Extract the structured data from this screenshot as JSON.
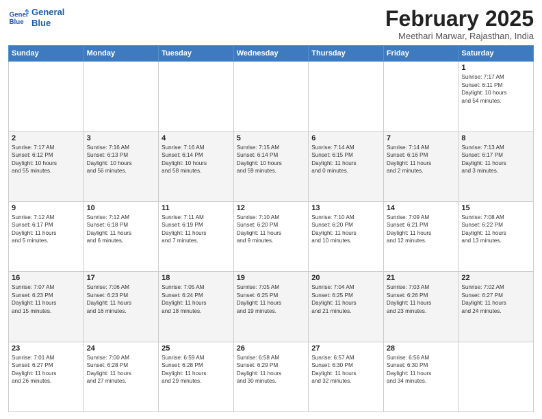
{
  "header": {
    "logo_line1": "General",
    "logo_line2": "Blue",
    "title": "February 2025",
    "subtitle": "Meethari Marwar, Rajasthan, India"
  },
  "weekdays": [
    "Sunday",
    "Monday",
    "Tuesday",
    "Wednesday",
    "Thursday",
    "Friday",
    "Saturday"
  ],
  "weeks": [
    [
      {
        "day": "",
        "info": ""
      },
      {
        "day": "",
        "info": ""
      },
      {
        "day": "",
        "info": ""
      },
      {
        "day": "",
        "info": ""
      },
      {
        "day": "",
        "info": ""
      },
      {
        "day": "",
        "info": ""
      },
      {
        "day": "1",
        "info": "Sunrise: 7:17 AM\nSunset: 6:11 PM\nDaylight: 10 hours\nand 54 minutes."
      }
    ],
    [
      {
        "day": "2",
        "info": "Sunrise: 7:17 AM\nSunset: 6:12 PM\nDaylight: 10 hours\nand 55 minutes."
      },
      {
        "day": "3",
        "info": "Sunrise: 7:16 AM\nSunset: 6:13 PM\nDaylight: 10 hours\nand 56 minutes."
      },
      {
        "day": "4",
        "info": "Sunrise: 7:16 AM\nSunset: 6:14 PM\nDaylight: 10 hours\nand 58 minutes."
      },
      {
        "day": "5",
        "info": "Sunrise: 7:15 AM\nSunset: 6:14 PM\nDaylight: 10 hours\nand 59 minutes."
      },
      {
        "day": "6",
        "info": "Sunrise: 7:14 AM\nSunset: 6:15 PM\nDaylight: 11 hours\nand 0 minutes."
      },
      {
        "day": "7",
        "info": "Sunrise: 7:14 AM\nSunset: 6:16 PM\nDaylight: 11 hours\nand 2 minutes."
      },
      {
        "day": "8",
        "info": "Sunrise: 7:13 AM\nSunset: 6:17 PM\nDaylight: 11 hours\nand 3 minutes."
      }
    ],
    [
      {
        "day": "9",
        "info": "Sunrise: 7:12 AM\nSunset: 6:17 PM\nDaylight: 11 hours\nand 5 minutes."
      },
      {
        "day": "10",
        "info": "Sunrise: 7:12 AM\nSunset: 6:18 PM\nDaylight: 11 hours\nand 6 minutes."
      },
      {
        "day": "11",
        "info": "Sunrise: 7:11 AM\nSunset: 6:19 PM\nDaylight: 11 hours\nand 7 minutes."
      },
      {
        "day": "12",
        "info": "Sunrise: 7:10 AM\nSunset: 6:20 PM\nDaylight: 11 hours\nand 9 minutes."
      },
      {
        "day": "13",
        "info": "Sunrise: 7:10 AM\nSunset: 6:20 PM\nDaylight: 11 hours\nand 10 minutes."
      },
      {
        "day": "14",
        "info": "Sunrise: 7:09 AM\nSunset: 6:21 PM\nDaylight: 11 hours\nand 12 minutes."
      },
      {
        "day": "15",
        "info": "Sunrise: 7:08 AM\nSunset: 6:22 PM\nDaylight: 11 hours\nand 13 minutes."
      }
    ],
    [
      {
        "day": "16",
        "info": "Sunrise: 7:07 AM\nSunset: 6:23 PM\nDaylight: 11 hours\nand 15 minutes."
      },
      {
        "day": "17",
        "info": "Sunrise: 7:06 AM\nSunset: 6:23 PM\nDaylight: 11 hours\nand 16 minutes."
      },
      {
        "day": "18",
        "info": "Sunrise: 7:05 AM\nSunset: 6:24 PM\nDaylight: 11 hours\nand 18 minutes."
      },
      {
        "day": "19",
        "info": "Sunrise: 7:05 AM\nSunset: 6:25 PM\nDaylight: 11 hours\nand 19 minutes."
      },
      {
        "day": "20",
        "info": "Sunrise: 7:04 AM\nSunset: 6:25 PM\nDaylight: 11 hours\nand 21 minutes."
      },
      {
        "day": "21",
        "info": "Sunrise: 7:03 AM\nSunset: 6:26 PM\nDaylight: 11 hours\nand 23 minutes."
      },
      {
        "day": "22",
        "info": "Sunrise: 7:02 AM\nSunset: 6:27 PM\nDaylight: 11 hours\nand 24 minutes."
      }
    ],
    [
      {
        "day": "23",
        "info": "Sunrise: 7:01 AM\nSunset: 6:27 PM\nDaylight: 11 hours\nand 26 minutes."
      },
      {
        "day": "24",
        "info": "Sunrise: 7:00 AM\nSunset: 6:28 PM\nDaylight: 11 hours\nand 27 minutes."
      },
      {
        "day": "25",
        "info": "Sunrise: 6:59 AM\nSunset: 6:28 PM\nDaylight: 11 hours\nand 29 minutes."
      },
      {
        "day": "26",
        "info": "Sunrise: 6:58 AM\nSunset: 6:29 PM\nDaylight: 11 hours\nand 30 minutes."
      },
      {
        "day": "27",
        "info": "Sunrise: 6:57 AM\nSunset: 6:30 PM\nDaylight: 11 hours\nand 32 minutes."
      },
      {
        "day": "28",
        "info": "Sunrise: 6:56 AM\nSunset: 6:30 PM\nDaylight: 11 hours\nand 34 minutes."
      },
      {
        "day": "",
        "info": ""
      }
    ]
  ]
}
